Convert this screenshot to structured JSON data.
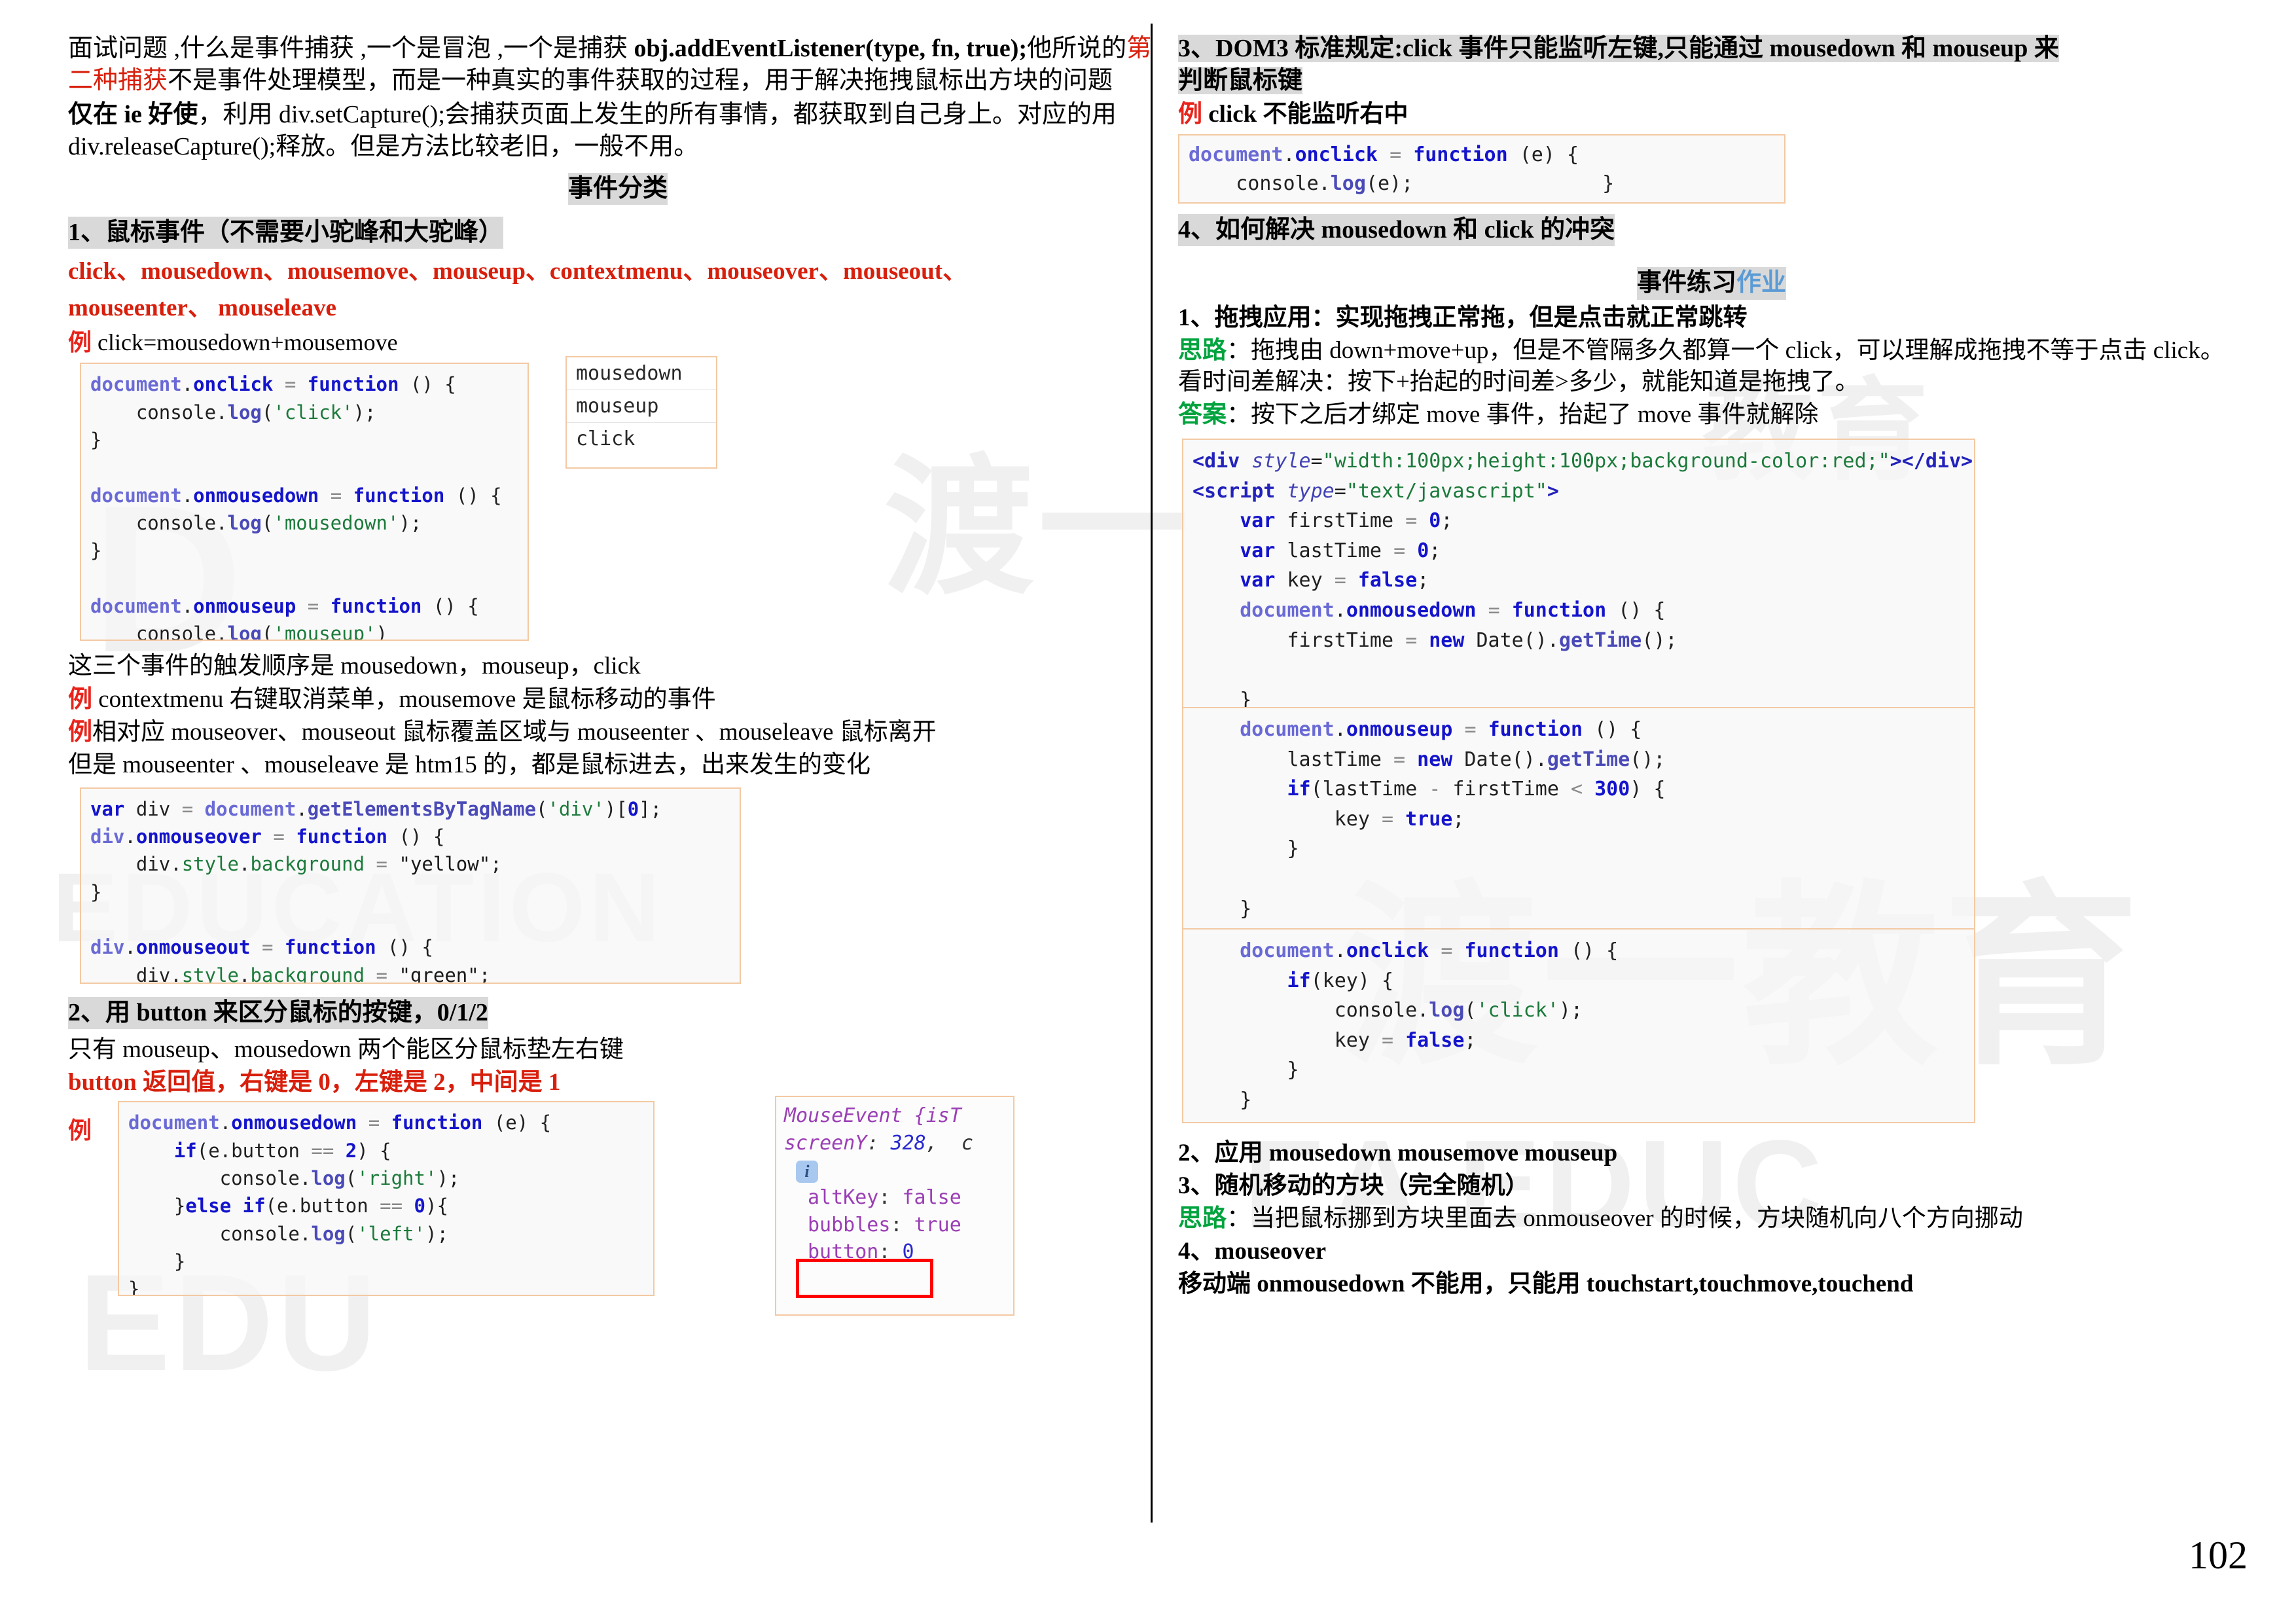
{
  "page": {
    "number": "102"
  },
  "left": {
    "intro": {
      "line1_a": "面试问题 ,什么是事件捕获 ,一个是冒泡 ,一个是捕获 ",
      "line1_b": "obj.addEventListener(type, fn, true);",
      "line2_a": "他所说的",
      "line2_red": "第二种捕获",
      "line2_b": "不是事件处理模型，而是一种真实的事件获取的过程，用于解决拖拽鼠标出方块的问题",
      "line3_bold": "仅在 ie 好使",
      "line3_rest": "，利用 div.setCapture();会捕获页面上发生的所有事情，都获取到自己身上。对应的用 div.releaseCapture();释放。但是方法比较老旧，一般不用。"
    },
    "section_title": "事件分类",
    "h1": "1、鼠标事件（不需要小驼峰和大驼峰）",
    "event_list_line1": "click、mousedown、mousemove、mouseup、contextmenu、mouseover、mouseout、",
    "event_list_line2": "mouseenter、   mouseleave",
    "ex_label": "例",
    "ex1_text": " click=mousedown+mousemove",
    "code1": {
      "lines": [
        "document.onclick = function () {",
        "    console.log('click');",
        "}",
        "",
        "document.onmousedown = function () {",
        "    console.log('mousedown');",
        "}",
        "",
        "document.onmouseup = function () {",
        "    console.log('mouseup')",
        "}"
      ]
    },
    "console_rows": [
      "mousedown",
      "mouseup",
      "click"
    ],
    "order_text": "这三个事件的触发顺序是 mousedown，mouseup，click",
    "ex2_text": " contextmenu 右键取消菜单，mousemove 是鼠标移动的事件",
    "ex3_text": "相对应 mouseover、mouseout 鼠标覆盖区域与 mouseenter 、mouseleave 鼠标离开",
    "ex3_cont": "但是 mouseenter 、mouseleave 是 htm15 的，都是鼠标进去，出来发生的变化",
    "code2": {
      "lines": [
        "var div = document.getElementsByTagName('div')[0];",
        "div.onmouseover = function () {",
        "    div.style.background = \"yellow\";",
        "}",
        "",
        "div.onmouseout = function () {",
        "    div.style.background = \"green\";",
        "}"
      ]
    },
    "h2": "2、用 button 来区分鼠标的按键，0/1/2",
    "only_text": "只有 mouseup、mousedown 两个能区分鼠标垫左右键",
    "button_return": "button 返回值，右键是 0，左键是 2，中间是 1",
    "code3": {
      "lines": [
        "document.onmousedown = function (e) {",
        "    if(e.button == 2) {",
        "        console.log('right');",
        "    }else if(e.button == 0){",
        "        console.log('left');",
        "    }",
        "}"
      ]
    },
    "inspector": {
      "line1": "MouseEvent {isT",
      "line2_key": "screenY",
      "line2_val": "328",
      "line2_tail": ",  c",
      "info_icon": "i",
      "rows": [
        {
          "key": "altKey",
          "value": "false",
          "highlight": false
        },
        {
          "key": "bubbles",
          "value": "true",
          "highlight": false
        },
        {
          "key": "button",
          "value": "0",
          "highlight": true
        }
      ]
    }
  },
  "right": {
    "h3": "3、DOM3 标准规定:click 事件只能监听左键,只能通过 mousedown 和 mouseup 来判断鼠标键",
    "h3_line1": "3、DOM3 标准规定:click 事件只能监听左键,只能通过 mousedown 和 mouseup 来",
    "h3_line2": "判断鼠标键",
    "ex_label": "例",
    "ex_text": " click 不能监听右中",
    "code_click": {
      "lines": [
        "document.onclick = function (e) {",
        "    console.log(e);                }"
      ]
    },
    "h4": "4、如何解决 mousedown 和 click 的冲突",
    "practice_title_a": "事件练习",
    "practice_title_b": "作业",
    "item1_label": "1、拖拽应用：",
    "item1_text": "实现拖拽正常拖，但是点击就正常跳转",
    "idea_label": "思路",
    "idea_text": "：拖拽由 down+move+up，但是不管隔多久都算一个 click，可以理解成拖拽不等于点击 click。看时间差解决：按下+抬起的时间差>多少，就能知道是拖拽了。",
    "answer_label": "答案",
    "answer_text": "：按下之后才绑定 move 事件，抬起了 move 事件就解除",
    "code_main": {
      "part1": [
        "<div style=\"width:100px;height:100px;background-color:red;\"></div>",
        "<script type=\"text/javascript\">",
        "    var firstTime = 0;",
        "    var lastTime = 0;",
        "    var key = false;",
        "    document.onmousedown = function () {",
        "        firstTime = new Date().getTime();",
        "",
        "    }"
      ],
      "part2": [
        "    document.onmouseup = function () {",
        "        lastTime = new Date().getTime();",
        "        if(lastTime - firstTime < 300) {",
        "            key = true;",
        "        }",
        "",
        "    }"
      ],
      "part3": [
        "    document.onclick = function () {",
        "        if(key) {",
        "            console.log('click');",
        "            key = false;",
        "        }",
        "    }"
      ]
    },
    "item2": "2、应用  mousedown mousemove mouseup",
    "item3": "3、随机移动的方块（完全随机）",
    "idea2_label": "思路",
    "idea2_text": "：当把鼠标挪到方块里面去 onmouseover 的时候，方块随机向八个方向挪动",
    "item4": "4、mouseover",
    "mobile_line": "移动端 onmousedown 不能用，只能用 touchstart,touchmove,touchend"
  },
  "watermark": {
    "marks": [
      "D",
      "EDUCATION",
      "渡一",
      "EDU",
      "渡一教育",
      "EA EDUC",
      "教育"
    ]
  }
}
